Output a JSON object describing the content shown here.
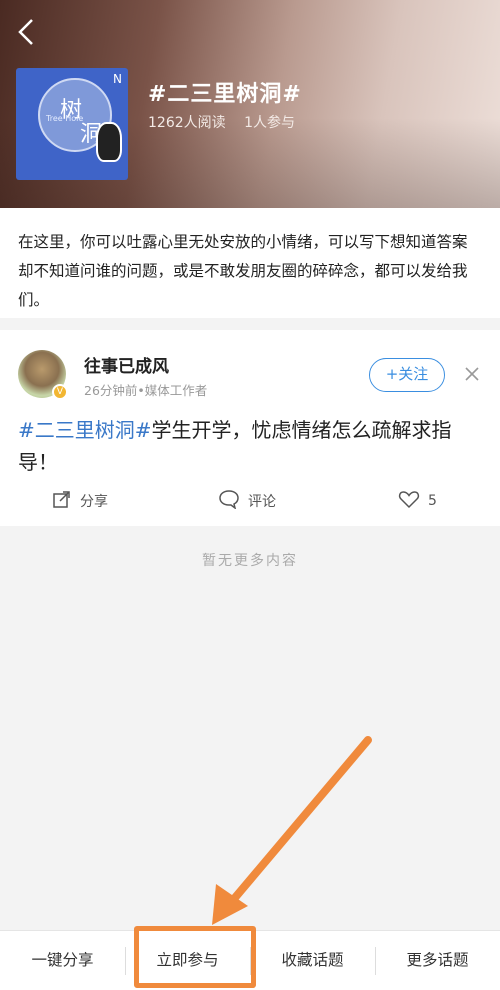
{
  "header": {
    "topic_title": "#二三里树洞#",
    "reads": "1262人阅读",
    "participants": "1人参与",
    "cover_text_1": "树",
    "cover_text_2": "洞",
    "cover_small": "Tree Hole",
    "cover_n": "N"
  },
  "description": "在这里，你可以吐露心里无处安放的小情绪，可以写下想知道答案却不知道问谁的问题，或是不敢发朋友圈的碎碎念，都可以发给我们。",
  "post": {
    "author": "往事已成风",
    "meta": "26分钟前•媒体工作者",
    "badge": "V",
    "follow_label": "+关注",
    "tag": "#二三里树洞#",
    "body": "学生开学，忧虑情绪怎么疏解求指导！",
    "share_label": "分享",
    "comment_label": "评论",
    "like_count": "5"
  },
  "empty_text": "暂无更多内容",
  "bottom_bar": {
    "share_all": "一键分享",
    "join_now": "立即参与",
    "favorite": "收藏话题",
    "more_topics": "更多话题"
  },
  "colors": {
    "accent_blue": "#3a8ee0",
    "highlight_orange": "#f08a3c"
  }
}
